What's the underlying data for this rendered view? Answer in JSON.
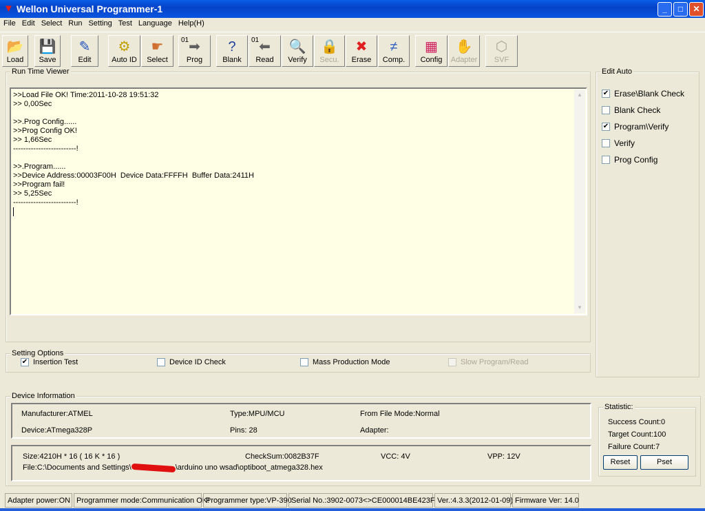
{
  "window": {
    "title": "Wellon Universal Programmer-1"
  },
  "menu": [
    "File",
    "Edit",
    "Select",
    "Run",
    "Setting",
    "Test",
    "Language",
    "Help(H)"
  ],
  "toolbar": [
    {
      "label": "Load",
      "icon": "folder-open-icon",
      "enabled": true
    },
    {
      "label": "Save",
      "icon": "floppy-disk-icon",
      "enabled": true
    },
    {
      "label": "Edit",
      "icon": "edit-icon",
      "enabled": true
    },
    {
      "label": "Auto ID",
      "icon": "chip-gear-icon",
      "enabled": true
    },
    {
      "label": "Select",
      "icon": "chip-hand-icon",
      "enabled": true
    },
    {
      "label": "Prog",
      "icon": "chip-arrow-in-icon",
      "badge": "01",
      "enabled": true
    },
    {
      "label": "Blank",
      "icon": "chip-question-icon",
      "enabled": true
    },
    {
      "label": "Read",
      "icon": "chip-arrow-out-icon",
      "badge": "01",
      "enabled": true
    },
    {
      "label": "Verify",
      "icon": "chip-magnifier-icon",
      "enabled": true
    },
    {
      "label": "Secu.",
      "icon": "lock-icon",
      "enabled": false
    },
    {
      "label": "Erase",
      "icon": "chip-erase-icon",
      "enabled": true
    },
    {
      "label": "Comp.",
      "icon": "compare-icon",
      "enabled": true
    },
    {
      "label": "Config",
      "icon": "config-blocks-icon",
      "enabled": true
    },
    {
      "label": "Adapter",
      "icon": "adapter-icon",
      "enabled": false
    },
    {
      "label": "SVF",
      "icon": "svf-icon",
      "enabled": false
    }
  ],
  "runtime": {
    "title": "Run Time Viewer",
    "lines": [
      ">>Load File OK! Time:2011-10-28 19:51:32",
      ">> 0,00Sec",
      "",
      ">>.Prog Config......",
      ">>Prog Config OK!",
      ">> 1,66Sec",
      "-------------------------!",
      "",
      ">>.Program......",
      ">>Device Address:00003F00H  Device Data:FFFFH  Buffer Data:2411H",
      ">>Program fail!",
      ">> 5,25Sec",
      "-------------------------!"
    ]
  },
  "settings": {
    "title": "Setting Options",
    "options": [
      {
        "label": "Insertion Test",
        "checked": true,
        "enabled": true
      },
      {
        "label": "Device ID Check",
        "checked": false,
        "enabled": true
      },
      {
        "label": "Mass Production Mode",
        "checked": false,
        "enabled": true
      },
      {
        "label": "Slow Program/Read",
        "checked": false,
        "enabled": false
      }
    ]
  },
  "edit_auto": {
    "title": "Edit Auto",
    "options": [
      {
        "label": "Erase\\Blank Check",
        "checked": true
      },
      {
        "label": "Blank Check",
        "checked": false
      },
      {
        "label": "Program\\Verify",
        "checked": true
      },
      {
        "label": "Verify",
        "checked": false
      },
      {
        "label": "Prog Config",
        "checked": false
      }
    ]
  },
  "device": {
    "title": "Device Information",
    "manufacturer": "Manufacturer:ATMEL",
    "type": "Type:MPU/MCU",
    "from_file_mode": "From File Mode:Normal",
    "device": "Device:ATmega328P",
    "pins": "Pins: 28",
    "adapter": "Adapter:",
    "size": "Size:4210H * 16 ( 16 K * 16 )",
    "checksum": "CheckSum:0082B37F",
    "vcc": "VCC: 4V",
    "vpp": "VPP: 12V",
    "file_prefix": "File:C:\\Documents and Settings\\",
    "file_suffix": "\\arduino uno wsad\\optiboot_atmega328.hex"
  },
  "statistic": {
    "title": "Statistic:",
    "success": "Success Count:0",
    "target": "Target Count:100",
    "failure": "Failure Count:7",
    "reset": "Reset",
    "pset": "Pset"
  },
  "status": [
    "Adapter power:ON",
    "Programmer mode:Communication OK!",
    "Programmer type:VP-390",
    "Serial No.:3902-0073<>CE000014BE423F",
    "Ver.:4.3.3(2012-01-09)",
    "Firmware Ver: 14.0"
  ]
}
